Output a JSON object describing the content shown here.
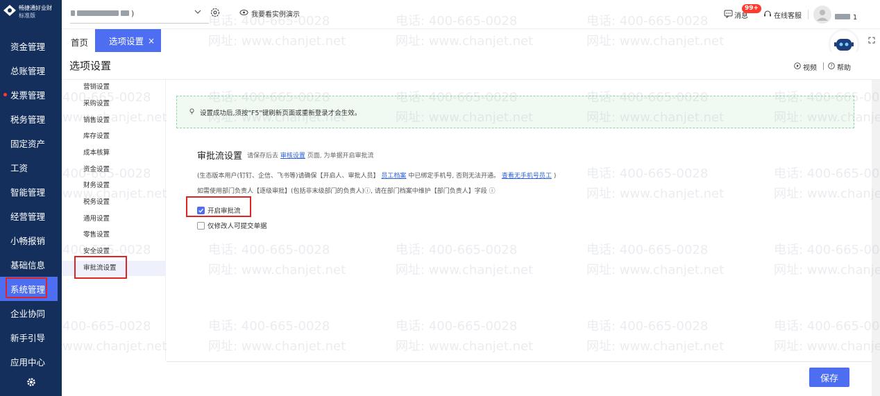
{
  "app": {
    "name": "畅捷通好业财",
    "edition": "标准版"
  },
  "sidebar": {
    "items": [
      {
        "label": "资金管理"
      },
      {
        "label": "总账管理"
      },
      {
        "label": "发票管理"
      },
      {
        "label": "税务管理"
      },
      {
        "label": "固定资产"
      },
      {
        "label": "工资"
      },
      {
        "label": "智能管理"
      },
      {
        "label": "经营管理"
      },
      {
        "label": "小畅报销"
      },
      {
        "label": "基础信息"
      },
      {
        "label": "系统管理"
      },
      {
        "label": "企业协同"
      },
      {
        "label": "新手引导"
      },
      {
        "label": "应用中心"
      }
    ],
    "active_item": "系统管理",
    "dot_item": "发票管理"
  },
  "topbar": {
    "company_suffix": ")",
    "demo_label": "我要看实例演示",
    "messages_label": "消息",
    "messages_badge": "99+",
    "service_label": "在线客服",
    "user_suffix": "1"
  },
  "tabs": {
    "home": "首页",
    "active": "选项设置",
    "close": "×"
  },
  "page": {
    "title": "选项设置",
    "video": "视频",
    "help": "帮助"
  },
  "settings_nav": {
    "items": [
      {
        "label": "营销设置"
      },
      {
        "label": "采购设置"
      },
      {
        "label": "销售设置"
      },
      {
        "label": "库存设置"
      },
      {
        "label": "成本核算"
      },
      {
        "label": "资金设置"
      },
      {
        "label": "财务设置"
      },
      {
        "label": "税务设置"
      },
      {
        "label": "通用设置"
      },
      {
        "label": "零售设置"
      },
      {
        "label": "安全设置"
      },
      {
        "label": "审批流设置"
      }
    ],
    "active": "审批流设置"
  },
  "notice": "设置成功后,须按\"F5\"键刷新页面或重新登录才会生效。",
  "section": {
    "title": "审批流设置",
    "hint_before": "请保存后去",
    "hint_link": "审核设置",
    "hint_after": "页面, 为单据开启审批流",
    "line1_before": "(生态版本用户(钉钉、企信、飞书等)请确保【开启人、审批人员】",
    "line1_link": "员工档案",
    "line1_middle": "中已绑定手机号, 否则无法开通。",
    "line1_link2": "查看无手机号员工",
    "line1_after": ")",
    "line2": "如需使用部门负责人【逐级审批】(包括非末级部门的负责人)ⓘ, 请在部门档案中维护【部门负责人】字段 ⓘ",
    "option1": "开启审批流",
    "option1_checked": true,
    "option2": "仅修改人可提交单据",
    "option2_checked": false
  },
  "buttons": {
    "save": "保存"
  },
  "watermark": {
    "phone": "电话: 400-665-0028",
    "site": "网址: www.chanjet.net",
    "phone_part": "400-665-0028",
    "site_part": "www.chanjet.net"
  },
  "colors": {
    "sidebar": "#142f5c",
    "accent": "#4e6ef2",
    "highlight": "#e02424",
    "notice_bg": "#f0faf2"
  }
}
